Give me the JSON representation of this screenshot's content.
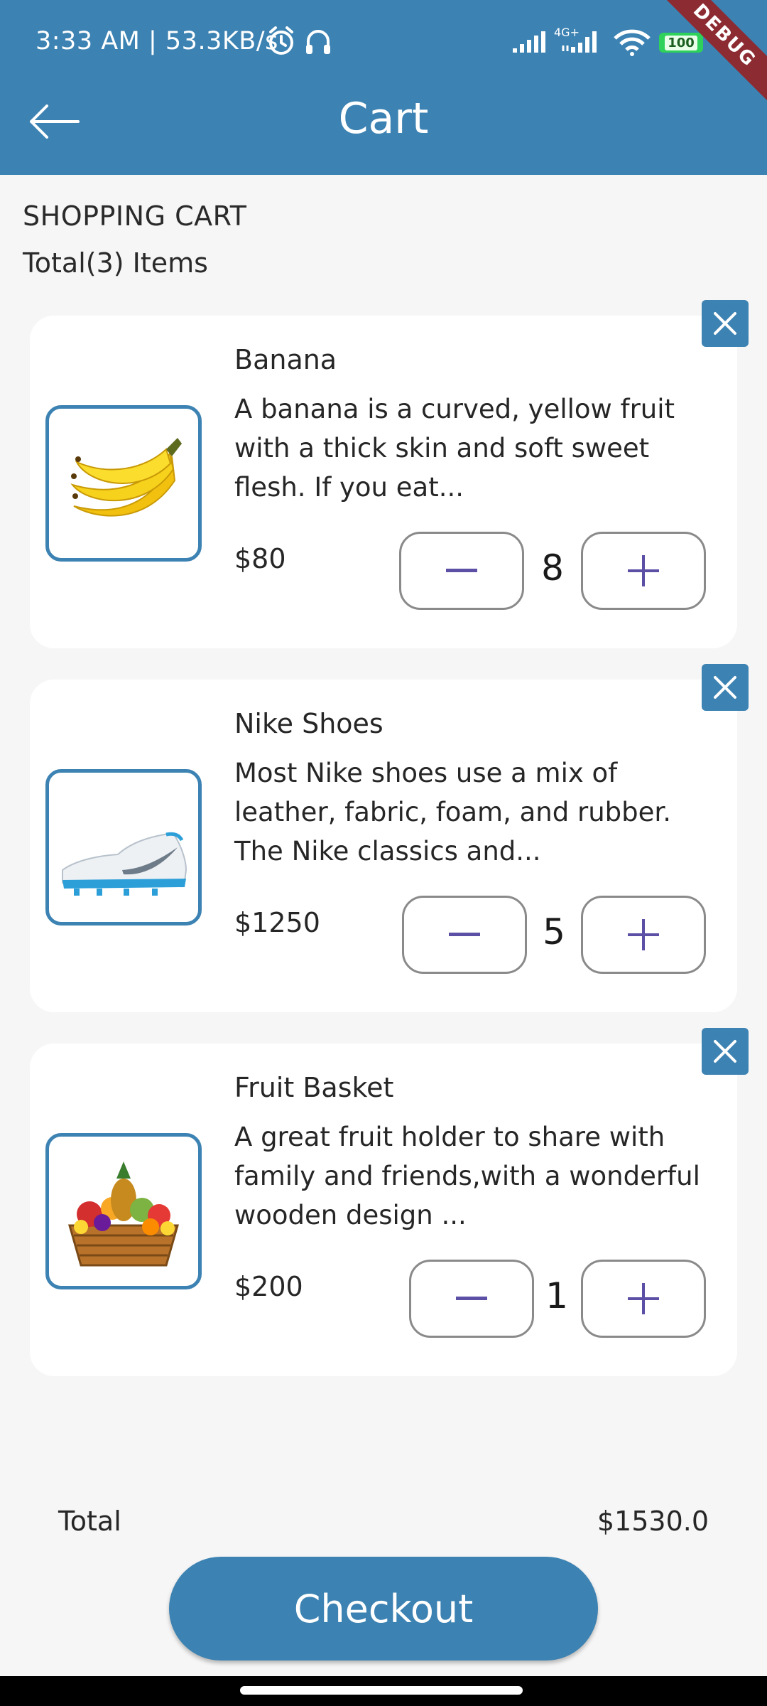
{
  "status_bar": {
    "time_speed": "3:33 AM | 53.3KB/s",
    "network_label": "4G+",
    "battery": "100",
    "debug_label": "DEBUG"
  },
  "app_bar": {
    "title": "Cart"
  },
  "cart": {
    "heading": "SHOPPING CART",
    "subheading": "Total(3) Items",
    "items": [
      {
        "title": "Banana",
        "description": "A banana is a curved, yellow fruit with a thick skin and soft sweet flesh. If you eat...",
        "price": "$80",
        "quantity": "8",
        "image": "banana-image"
      },
      {
        "title": "Nike Shoes",
        "description": "Most Nike shoes use a mix of leather, fabric, foam, and rubber. The Nike classics and...",
        "price": "$1250",
        "quantity": "5",
        "image": "nike-shoe-image"
      },
      {
        "title": "Fruit Basket",
        "description": "A great fruit holder to share with family and friends,with a wonderful wooden design ...",
        "price": "$200",
        "quantity": "1",
        "image": "fruit-basket-image"
      }
    ]
  },
  "footer": {
    "total_label": "Total",
    "total_value": "$1530.0",
    "checkout_label": "Checkout"
  },
  "colors": {
    "primary": "#3c82b2",
    "qty_icon": "#5b4fa6",
    "debug": "#8d2b32",
    "background": "#f6f6f6"
  }
}
